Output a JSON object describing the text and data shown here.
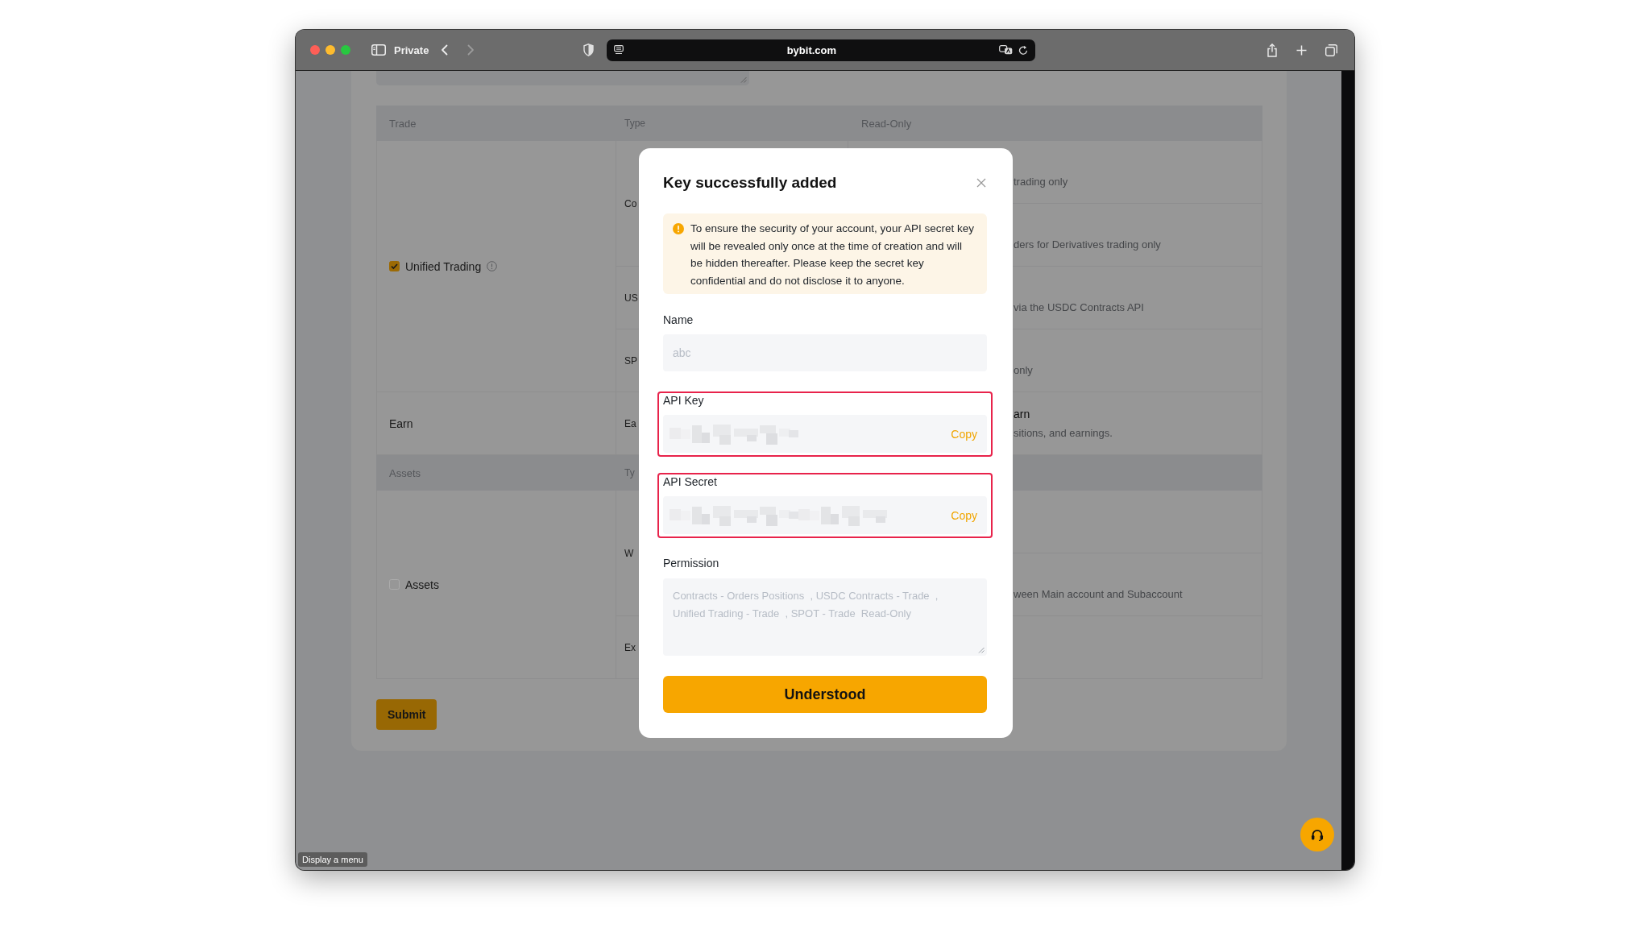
{
  "browser": {
    "mode": "Private",
    "url": "bybit.com",
    "back_disabled": false,
    "forward_disabled": true
  },
  "page": {
    "top_field": {
      "resizable": true
    },
    "table": {
      "sections": [
        {
          "columns": [
            "Trade",
            "Type",
            "Read-Only"
          ],
          "groups": [
            {
              "kind": "checkbox",
              "label": "Unified Trading",
              "checked": true,
              "info_icon": true,
              "types": [
                {
                  "label": "Co",
                  "rows": [
                    {
                      "kind": "option",
                      "description": "trading only"
                    },
                    {
                      "kind": "option",
                      "description": "ders for Derivatives trading only"
                    }
                  ]
                },
                {
                  "label": "US",
                  "rows": [
                    {
                      "kind": "option",
                      "description": "via the USDC Contracts API"
                    }
                  ]
                },
                {
                  "label": "SP",
                  "rows": [
                    {
                      "kind": "option",
                      "description": "only"
                    }
                  ]
                }
              ]
            },
            {
              "kind": "plain",
              "label": "Earn",
              "types": [
                {
                  "label": "Ea",
                  "rows": [
                    {
                      "kind": "option",
                      "title": "arn",
                      "description": "sitions, and earnings."
                    }
                  ]
                }
              ]
            }
          ]
        },
        {
          "columns": [
            "Assets",
            "Ty"
          ],
          "groups": [
            {
              "kind": "checkbox",
              "label": "Assets",
              "checked": false,
              "types": [
                {
                  "label": "W",
                  "rows": [
                    {
                      "kind": "blank"
                    },
                    {
                      "kind": "option",
                      "description": "ween Main account and Subaccount"
                    }
                  ]
                },
                {
                  "label": "Ex",
                  "rows": [
                    {
                      "kind": "blank"
                    }
                  ]
                }
              ]
            }
          ]
        }
      ]
    },
    "submit_button": "Submit"
  },
  "dialog": {
    "title": "Key successfully added",
    "notice": {
      "kind": "warning",
      "text": "To ensure the security of your account, your API secret key will be revealed only once at the time of creation and will be hidden thereafter. Please keep the secret key confidential and do not disclose it to anyone."
    },
    "fields": [
      {
        "kind": "input",
        "label": "Name",
        "value": "abc",
        "disabled": true,
        "highlighted": false
      },
      {
        "kind": "secret",
        "label": "API Key",
        "redacted": true,
        "action": "Copy",
        "disabled": false,
        "highlighted": true
      },
      {
        "kind": "secret",
        "label": "API Secret",
        "redacted": true,
        "action": "Copy",
        "disabled": false,
        "highlighted": true
      },
      {
        "kind": "textarea",
        "label": "Permission",
        "value": "Contracts - Orders Positions  , USDC Contracts - Trade  , Unified Trading - Trade  , SPOT - Trade  Read-Only",
        "disabled": true,
        "resizable": true,
        "highlighted": false
      }
    ],
    "confirm_button": "Understood"
  },
  "tooltip": "Display a menu"
}
